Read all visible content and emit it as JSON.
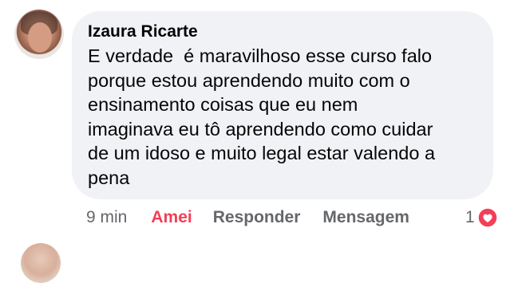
{
  "comment": {
    "author": "Izaura Ricarte",
    "text": "E verdade  é maravilhoso esse curso falo\nporque estou aprendendo muito com o\nensinamento coisas que eu nem\nimaginava eu tô aprendendo como cuidar\nde um idoso e muito legal estar valendo a\npena",
    "time": "9 min",
    "reaction_label": "Amei",
    "reply_label": "Responder",
    "message_label": "Mensagem",
    "reaction_count": "1",
    "reaction_icon": "heart-icon",
    "reaction_color": "#f33e58"
  }
}
